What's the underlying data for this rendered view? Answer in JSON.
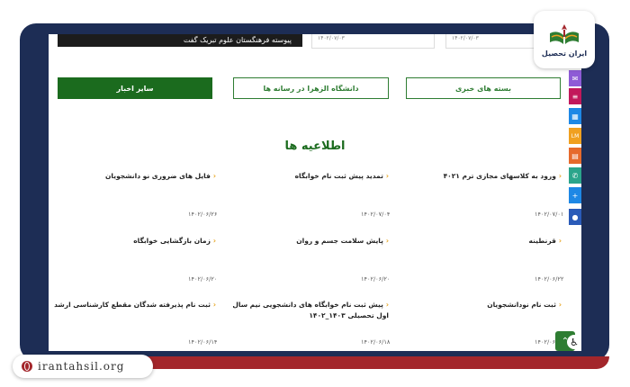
{
  "top": {
    "dark_bar_text": "پیوسته فرهنگستان علوم تبریک گفت",
    "card_dates": [
      "۱۴۰۲/۰۷/۰۳",
      "۱۴۰۲/۰۷/۰۳"
    ]
  },
  "buttons": {
    "news_packages": "بسته های خبری",
    "alzahra_media": "دانشگاه الزهرا در رسانه ها",
    "other_news": "سایر اخبار"
  },
  "section_title": "اطلاعیه ها",
  "announcements": [
    {
      "title": "ورود به کلاسهای مجازی ترم ۴۰۲۱",
      "date": "۱۴۰۲/۰۷/۰۱"
    },
    {
      "title": "تمدید پیش ثبت نام خوابگاه",
      "date": "۱۴۰۲/۰۷/۰۴"
    },
    {
      "title": "فایل های ضروری نو دانشجویان",
      "date": "۱۴۰۲/۰۶/۲۶"
    },
    {
      "title": "قرنطینه",
      "date": "۱۴۰۲/۰۶/۲۲"
    },
    {
      "title": "پایش سلامت جسم و روان",
      "date": "۱۴۰۲/۰۶/۲۰"
    },
    {
      "title": "زمان بازگشایی خوابگاه",
      "date": "۱۴۰۲/۰۶/۲۰"
    },
    {
      "title": "ثبت نام نودانشجویان",
      "date": "۱۴۰۲/۰۶/۱۷"
    },
    {
      "title": "پیش ثبت نام خوابگاه های دانشجویی نیم سال اول تحصیلی ۱۴۰۳_۱۴۰۲",
      "date": "۱۴۰۲/۰۶/۱۸"
    },
    {
      "title": "ثبت نام پذیرفته شدگان مقطع کارشناسی ارشد",
      "date": "۱۴۰۲/۰۶/۱۴"
    }
  ],
  "side_tools": [
    {
      "icon": "mail-icon",
      "color": "#8e5bd6"
    },
    {
      "icon": "list-icon",
      "color": "#c2185b"
    },
    {
      "icon": "grid-icon",
      "color": "#1e88e5"
    },
    {
      "icon": "lms-icon",
      "color": "#f0a020",
      "label": "LM"
    },
    {
      "icon": "book-icon",
      "color": "#e66a2c"
    },
    {
      "icon": "phone-icon",
      "color": "#2ba58b"
    },
    {
      "icon": "plus-icon",
      "color": "#1e88e5"
    },
    {
      "icon": "chat-icon",
      "color": "#2a5bb8"
    }
  ],
  "logo": {
    "text": "ایران تحصیل"
  },
  "url": "irantahsil.org",
  "colors": {
    "frame": "#1d2d55",
    "accent_green": "#1b6b1e",
    "chevron": "#e6a21a",
    "strip_red": "#a3262b"
  }
}
